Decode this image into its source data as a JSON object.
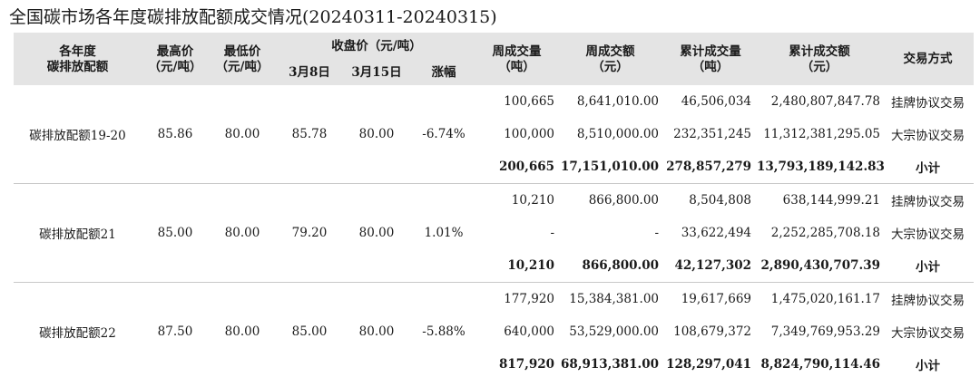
{
  "title": "全国碳市场各年度碳排放配额成交情况(20240311-20240315)",
  "headers": {
    "col1": "各年度\n碳排放配额",
    "high": "最高价\n（元/吨）",
    "low": "最低价\n（元/吨）",
    "close_group": "收盘价（元/吨）",
    "close_d1": "3月8日",
    "close_d2": "3月15日",
    "change": "涨幅",
    "week_vol": "周成交量\n（吨）",
    "week_amt": "周成交额\n（元）",
    "cum_vol": "累计成交量\n（吨）",
    "cum_amt": "累计成交额\n（元）",
    "method": "交易方式"
  },
  "groups": [
    {
      "name": "碳排放配额19-20",
      "high": "85.86",
      "low": "80.00",
      "close_d1": "85.78",
      "close_d2": "80.00",
      "change": "-6.74%",
      "rows": [
        {
          "week_vol": "100,665",
          "week_amt": "8,641,010.00",
          "cum_vol": "46,506,034",
          "cum_amt": "2,480,807,847.78",
          "method": "挂牌协议交易"
        },
        {
          "week_vol": "100,000",
          "week_amt": "8,510,000.00",
          "cum_vol": "232,351,245",
          "cum_amt": "11,312,381,295.05",
          "method": "大宗协议交易"
        },
        {
          "week_vol": "200,665",
          "week_amt": "17,151,010.00",
          "cum_vol": "278,857,279",
          "cum_amt": "13,793,189,142.83",
          "method": "小计"
        }
      ]
    },
    {
      "name": "碳排放配额21",
      "high": "85.00",
      "low": "80.00",
      "close_d1": "79.20",
      "close_d2": "80.00",
      "change": "1.01%",
      "rows": [
        {
          "week_vol": "10,210",
          "week_amt": "866,800.00",
          "cum_vol": "8,504,808",
          "cum_amt": "638,144,999.21",
          "method": "挂牌协议交易"
        },
        {
          "week_vol": "-",
          "week_amt": "-",
          "cum_vol": "33,622,494",
          "cum_amt": "2,252,285,708.18",
          "method": "大宗协议交易"
        },
        {
          "week_vol": "10,210",
          "week_amt": "866,800.00",
          "cum_vol": "42,127,302",
          "cum_amt": "2,890,430,707.39",
          "method": "小计"
        }
      ]
    },
    {
      "name": "碳排放配额22",
      "high": "87.50",
      "low": "80.00",
      "close_d1": "85.00",
      "close_d2": "80.00",
      "change": "-5.88%",
      "rows": [
        {
          "week_vol": "177,920",
          "week_amt": "15,384,381.00",
          "cum_vol": "19,617,669",
          "cum_amt": "1,475,020,161.17",
          "method": "挂牌协议交易"
        },
        {
          "week_vol": "640,000",
          "week_amt": "53,529,000.00",
          "cum_vol": "108,679,372",
          "cum_amt": "7,349,769,953.29",
          "method": "大宗协议交易"
        },
        {
          "week_vol": "817,920",
          "week_amt": "68,913,381.00",
          "cum_vol": "128,297,041",
          "cum_amt": "8,824,790,114.46",
          "method": "小计"
        }
      ]
    }
  ]
}
